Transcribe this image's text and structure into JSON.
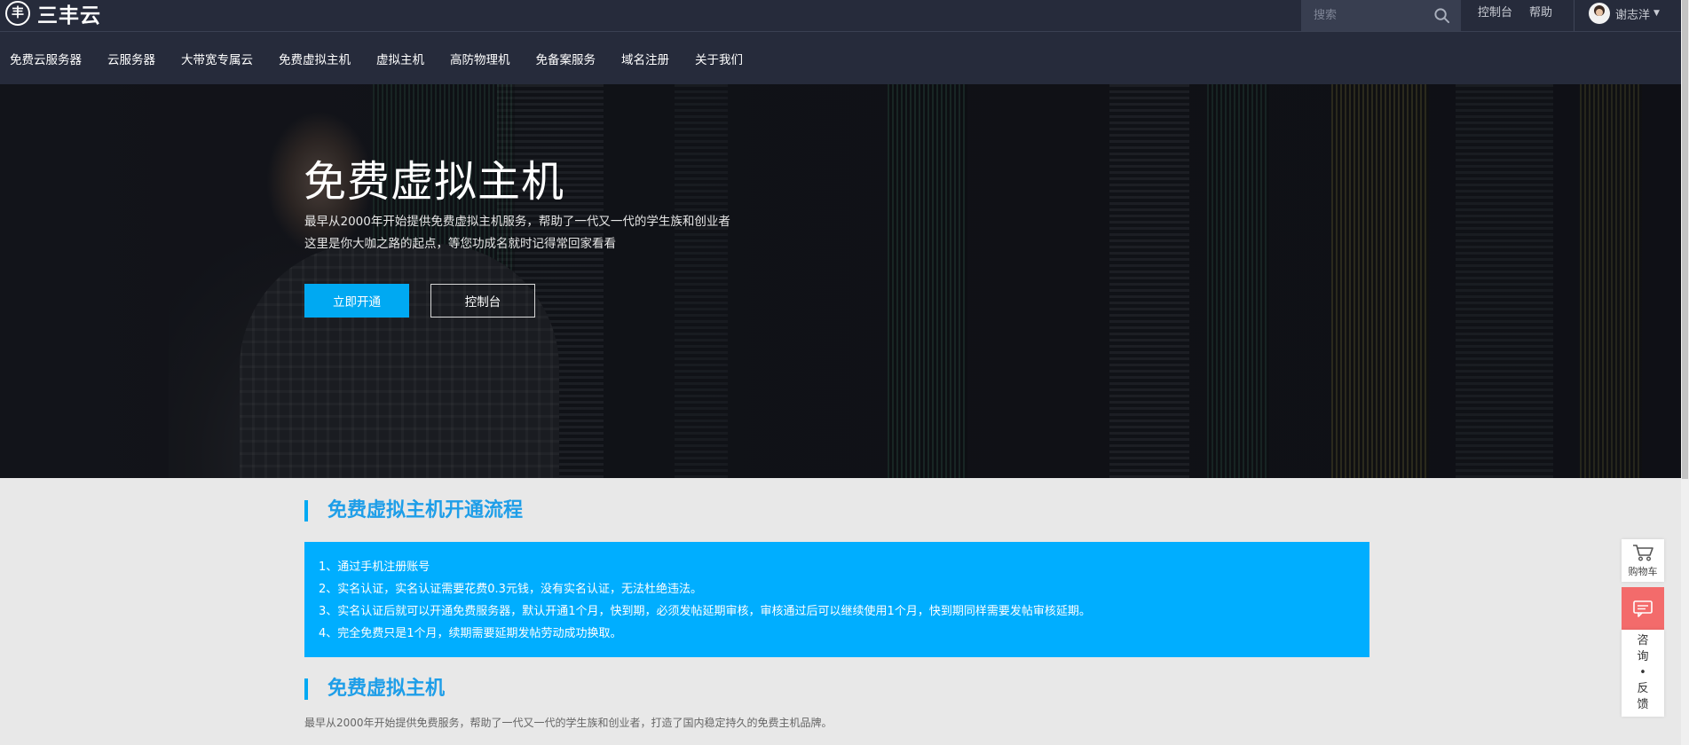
{
  "header": {
    "logo_text": "三丰云",
    "logo_mark": "丰",
    "search_placeholder": "搜索",
    "console_link": "控制台",
    "help_link": "帮助",
    "user_name": "谢志洋",
    "caret": "▼"
  },
  "nav": {
    "items": [
      "免费云服务器",
      "云服务器",
      "大带宽专属云",
      "免费虚拟主机",
      "虚拟主机",
      "高防物理机",
      "免备案服务",
      "域名注册",
      "关于我们"
    ]
  },
  "hero": {
    "title": "免费虚拟主机",
    "desc_line1": "最早从2000年开始提供免费虚拟主机服务，帮助了一代又一代的学生族和创业者",
    "desc_line2": "这里是你大咖之路的起点，等您功成名就时记得常回家看看",
    "primary_button": "立即开通",
    "secondary_button": "控制台"
  },
  "process": {
    "title": "免费虚拟主机开通流程",
    "steps": [
      "1、通过手机注册账号",
      "2、实名认证，实名认证需要花费0.3元钱，没有实名认证，无法杜绝违法。",
      "3、实名认证后就可以开通免费服务器，默认开通1个月，快到期，必须发帖延期审核，审核通过后可以继续使用1个月，快到期同样需要发帖审核延期。",
      "4、完全免费只是1个月，续期需要延期发帖劳动成功换取。"
    ]
  },
  "intro": {
    "title": "免费虚拟主机",
    "text": "最早从2000年开始提供免费服务，帮助了一代又一代的学生族和创业者，打造了国内稳定持久的免费主机品牌。"
  },
  "float": {
    "cart_label": "购物车",
    "feedback_chars": [
      "咨",
      "询",
      "•",
      "反",
      "馈"
    ]
  },
  "colors": {
    "accent": "#00a9f2",
    "header_bg": "#262b3b",
    "feedback": "#f36b6b"
  }
}
